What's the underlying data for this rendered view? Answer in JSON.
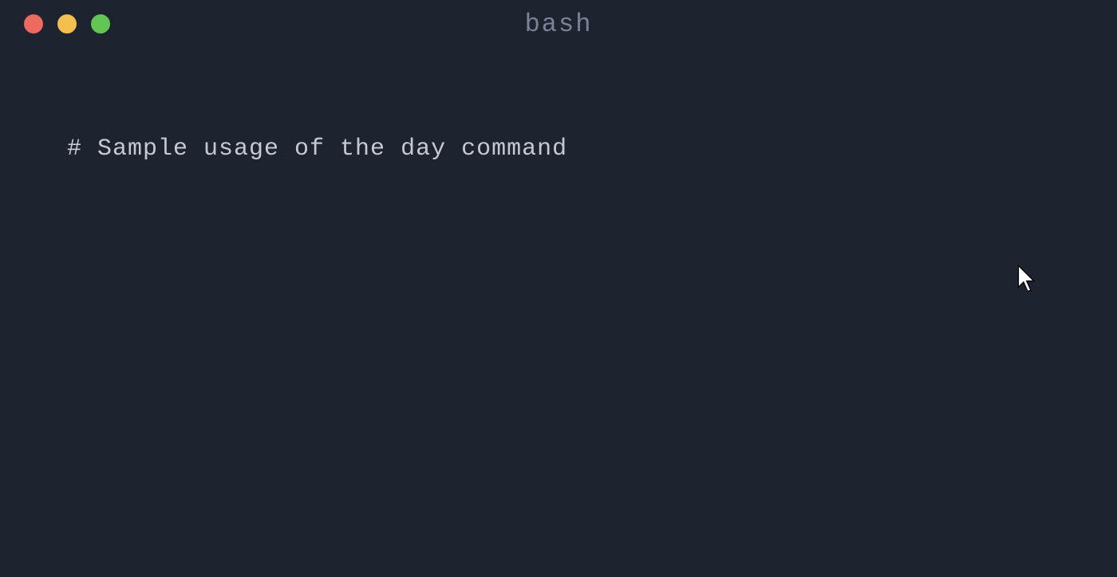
{
  "window": {
    "title": "bash"
  },
  "terminal": {
    "lines": [
      "# Sample usage of the day command"
    ]
  },
  "colors": {
    "background": "#1e2330",
    "text": "#c5c9d4",
    "title": "#7a8296",
    "close": "#ed6a5e",
    "minimize": "#f5bf4f",
    "zoom": "#62c554"
  }
}
